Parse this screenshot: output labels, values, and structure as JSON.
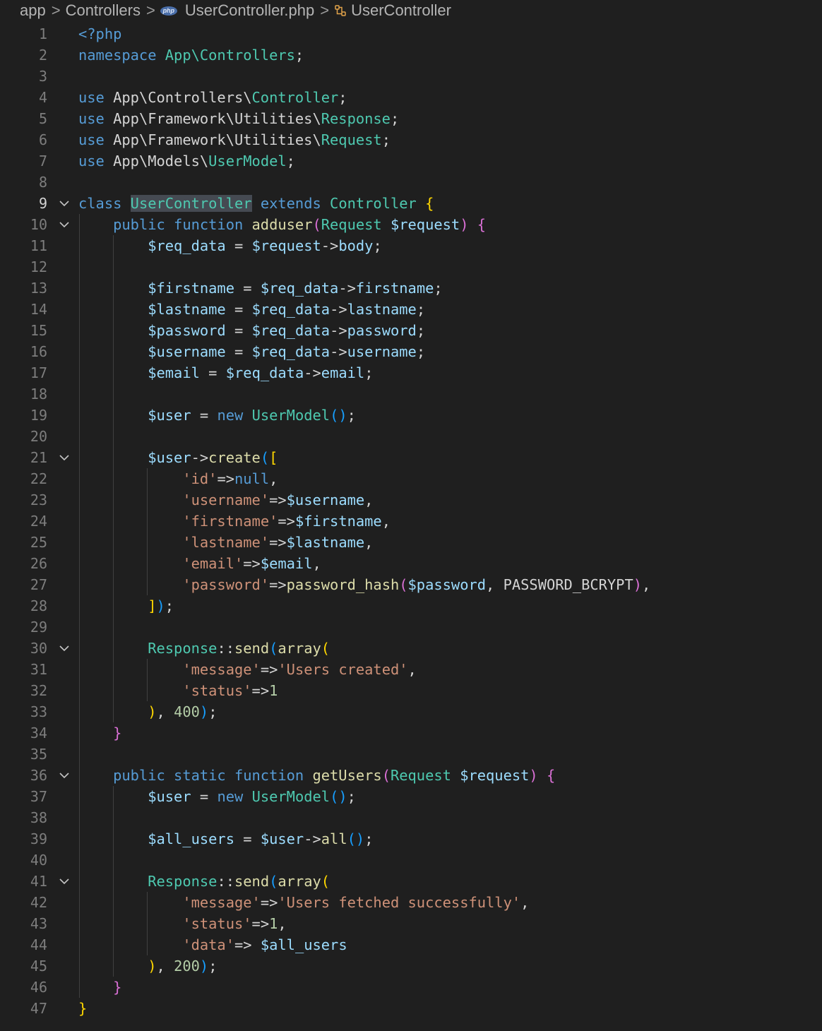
{
  "breadcrumb": {
    "items": [
      "app",
      "Controllers",
      "UserController.php",
      "UserController"
    ],
    "php_badge": "php"
  },
  "editor": {
    "language": "php",
    "active_line": 9,
    "fold_lines": [
      9,
      10,
      21,
      30,
      36,
      41
    ],
    "lines": [
      [
        [
          "<?php",
          "kw"
        ]
      ],
      [
        [
          "namespace ",
          "kw"
        ],
        [
          "App\\Controllers",
          "ty"
        ],
        [
          ";",
          "pl"
        ]
      ],
      [],
      [
        [
          "use ",
          "kw"
        ],
        [
          "App\\Controllers\\",
          "pl"
        ],
        [
          "Controller",
          "ty"
        ],
        [
          ";",
          "pl"
        ]
      ],
      [
        [
          "use ",
          "kw"
        ],
        [
          "App\\Framework\\Utilities\\",
          "pl"
        ],
        [
          "Response",
          "ty"
        ],
        [
          ";",
          "pl"
        ]
      ],
      [
        [
          "use ",
          "kw"
        ],
        [
          "App\\Framework\\Utilities\\",
          "pl"
        ],
        [
          "Request",
          "ty"
        ],
        [
          ";",
          "pl"
        ]
      ],
      [
        [
          "use ",
          "kw"
        ],
        [
          "App\\Models\\",
          "pl"
        ],
        [
          "UserModel",
          "ty"
        ],
        [
          ";",
          "pl"
        ]
      ],
      [],
      [
        [
          "class ",
          "kw"
        ],
        [
          "UserController",
          "ty hl"
        ],
        [
          " ",
          "pl"
        ],
        [
          "extends ",
          "kw"
        ],
        [
          "Controller",
          "ty"
        ],
        [
          " ",
          "pl"
        ],
        [
          "{",
          "p1"
        ]
      ],
      [
        [
          "    ",
          "pl"
        ],
        [
          "public function ",
          "kw"
        ],
        [
          "adduser",
          "fn"
        ],
        [
          "(",
          "p2"
        ],
        [
          "Request ",
          "ty"
        ],
        [
          "$request",
          "var"
        ],
        [
          ")",
          "p2"
        ],
        [
          " ",
          "pl"
        ],
        [
          "{",
          "p2"
        ]
      ],
      [
        [
          "        ",
          "pl"
        ],
        [
          "$req_data",
          "var"
        ],
        [
          " = ",
          "pl"
        ],
        [
          "$request",
          "var"
        ],
        [
          "->",
          "pl"
        ],
        [
          "body",
          "var"
        ],
        [
          ";",
          "pl"
        ]
      ],
      [],
      [
        [
          "        ",
          "pl"
        ],
        [
          "$firstname",
          "var"
        ],
        [
          " = ",
          "pl"
        ],
        [
          "$req_data",
          "var"
        ],
        [
          "->",
          "pl"
        ],
        [
          "firstname",
          "var"
        ],
        [
          ";",
          "pl"
        ]
      ],
      [
        [
          "        ",
          "pl"
        ],
        [
          "$lastname",
          "var"
        ],
        [
          " = ",
          "pl"
        ],
        [
          "$req_data",
          "var"
        ],
        [
          "->",
          "pl"
        ],
        [
          "lastname",
          "var"
        ],
        [
          ";",
          "pl"
        ]
      ],
      [
        [
          "        ",
          "pl"
        ],
        [
          "$password",
          "var"
        ],
        [
          " = ",
          "pl"
        ],
        [
          "$req_data",
          "var"
        ],
        [
          "->",
          "pl"
        ],
        [
          "password",
          "var"
        ],
        [
          ";",
          "pl"
        ]
      ],
      [
        [
          "        ",
          "pl"
        ],
        [
          "$username",
          "var"
        ],
        [
          " = ",
          "pl"
        ],
        [
          "$req_data",
          "var"
        ],
        [
          "->",
          "pl"
        ],
        [
          "username",
          "var"
        ],
        [
          ";",
          "pl"
        ]
      ],
      [
        [
          "        ",
          "pl"
        ],
        [
          "$email",
          "var"
        ],
        [
          " = ",
          "pl"
        ],
        [
          "$req_data",
          "var"
        ],
        [
          "->",
          "pl"
        ],
        [
          "email",
          "var"
        ],
        [
          ";",
          "pl"
        ]
      ],
      [],
      [
        [
          "        ",
          "pl"
        ],
        [
          "$user",
          "var"
        ],
        [
          " = ",
          "pl"
        ],
        [
          "new ",
          "kw"
        ],
        [
          "UserModel",
          "ty"
        ],
        [
          "()",
          "p3"
        ],
        [
          ";",
          "pl"
        ]
      ],
      [],
      [
        [
          "        ",
          "pl"
        ],
        [
          "$user",
          "var"
        ],
        [
          "->",
          "pl"
        ],
        [
          "create",
          "fn"
        ],
        [
          "(",
          "p3"
        ],
        [
          "[",
          "p1"
        ]
      ],
      [
        [
          "            ",
          "pl"
        ],
        [
          "'id'",
          "str"
        ],
        [
          "=>",
          "pl"
        ],
        [
          "null",
          "kw"
        ],
        [
          ",",
          "pl"
        ]
      ],
      [
        [
          "            ",
          "pl"
        ],
        [
          "'username'",
          "str"
        ],
        [
          "=>",
          "pl"
        ],
        [
          "$username",
          "var"
        ],
        [
          ",",
          "pl"
        ]
      ],
      [
        [
          "            ",
          "pl"
        ],
        [
          "'firstname'",
          "str"
        ],
        [
          "=>",
          "pl"
        ],
        [
          "$firstname",
          "var"
        ],
        [
          ",",
          "pl"
        ]
      ],
      [
        [
          "            ",
          "pl"
        ],
        [
          "'lastname'",
          "str"
        ],
        [
          "=>",
          "pl"
        ],
        [
          "$lastname",
          "var"
        ],
        [
          ",",
          "pl"
        ]
      ],
      [
        [
          "            ",
          "pl"
        ],
        [
          "'email'",
          "str"
        ],
        [
          "=>",
          "pl"
        ],
        [
          "$email",
          "var"
        ],
        [
          ",",
          "pl"
        ]
      ],
      [
        [
          "            ",
          "pl"
        ],
        [
          "'password'",
          "str"
        ],
        [
          "=>",
          "pl"
        ],
        [
          "password_hash",
          "fn"
        ],
        [
          "(",
          "p2"
        ],
        [
          "$password",
          "var"
        ],
        [
          ", PASSWORD_BCRYPT",
          "pl"
        ],
        [
          ")",
          "p2"
        ],
        [
          ",",
          "pl"
        ]
      ],
      [
        [
          "        ",
          "pl"
        ],
        [
          "]",
          "p1"
        ],
        [
          ")",
          "p3"
        ],
        [
          ";",
          "pl"
        ]
      ],
      [],
      [
        [
          "        ",
          "pl"
        ],
        [
          "Response",
          "ty"
        ],
        [
          "::",
          "pl"
        ],
        [
          "send",
          "fn"
        ],
        [
          "(",
          "p3"
        ],
        [
          "array",
          "fn"
        ],
        [
          "(",
          "p1"
        ]
      ],
      [
        [
          "            ",
          "pl"
        ],
        [
          "'message'",
          "str"
        ],
        [
          "=>",
          "pl"
        ],
        [
          "'Users created'",
          "str"
        ],
        [
          ",",
          "pl"
        ]
      ],
      [
        [
          "            ",
          "pl"
        ],
        [
          "'status'",
          "str"
        ],
        [
          "=>",
          "pl"
        ],
        [
          "1",
          "num"
        ]
      ],
      [
        [
          "        ",
          "pl"
        ],
        [
          ")",
          "p1"
        ],
        [
          ", ",
          "pl"
        ],
        [
          "400",
          "num"
        ],
        [
          ")",
          "p3"
        ],
        [
          ";",
          "pl"
        ]
      ],
      [
        [
          "    ",
          "pl"
        ],
        [
          "}",
          "p2"
        ]
      ],
      [],
      [
        [
          "    ",
          "pl"
        ],
        [
          "public static function ",
          "kw"
        ],
        [
          "getUsers",
          "fn"
        ],
        [
          "(",
          "p2"
        ],
        [
          "Request ",
          "ty"
        ],
        [
          "$request",
          "var"
        ],
        [
          ")",
          "p2"
        ],
        [
          " ",
          "pl"
        ],
        [
          "{",
          "p2"
        ]
      ],
      [
        [
          "        ",
          "pl"
        ],
        [
          "$user",
          "var"
        ],
        [
          " = ",
          "pl"
        ],
        [
          "new ",
          "kw"
        ],
        [
          "UserModel",
          "ty"
        ],
        [
          "()",
          "p3"
        ],
        [
          ";",
          "pl"
        ]
      ],
      [],
      [
        [
          "        ",
          "pl"
        ],
        [
          "$all_users",
          "var"
        ],
        [
          " = ",
          "pl"
        ],
        [
          "$user",
          "var"
        ],
        [
          "->",
          "pl"
        ],
        [
          "all",
          "fn"
        ],
        [
          "()",
          "p3"
        ],
        [
          ";",
          "pl"
        ]
      ],
      [],
      [
        [
          "        ",
          "pl"
        ],
        [
          "Response",
          "ty"
        ],
        [
          "::",
          "pl"
        ],
        [
          "send",
          "fn"
        ],
        [
          "(",
          "p3"
        ],
        [
          "array",
          "fn"
        ],
        [
          "(",
          "p1"
        ]
      ],
      [
        [
          "            ",
          "pl"
        ],
        [
          "'message'",
          "str"
        ],
        [
          "=>",
          "pl"
        ],
        [
          "'Users fetched successfully'",
          "str"
        ],
        [
          ",",
          "pl"
        ]
      ],
      [
        [
          "            ",
          "pl"
        ],
        [
          "'status'",
          "str"
        ],
        [
          "=>",
          "pl"
        ],
        [
          "1",
          "num"
        ],
        [
          ",",
          "pl"
        ]
      ],
      [
        [
          "            ",
          "pl"
        ],
        [
          "'data'",
          "str"
        ],
        [
          "=> ",
          "pl"
        ],
        [
          "$all_users",
          "var"
        ]
      ],
      [
        [
          "        ",
          "pl"
        ],
        [
          ")",
          "p1"
        ],
        [
          ", ",
          "pl"
        ],
        [
          "200",
          "num"
        ],
        [
          ")",
          "p3"
        ],
        [
          ";",
          "pl"
        ]
      ],
      [
        [
          "    ",
          "pl"
        ],
        [
          "}",
          "p2"
        ]
      ],
      [
        [
          "}",
          "p1"
        ]
      ]
    ]
  }
}
